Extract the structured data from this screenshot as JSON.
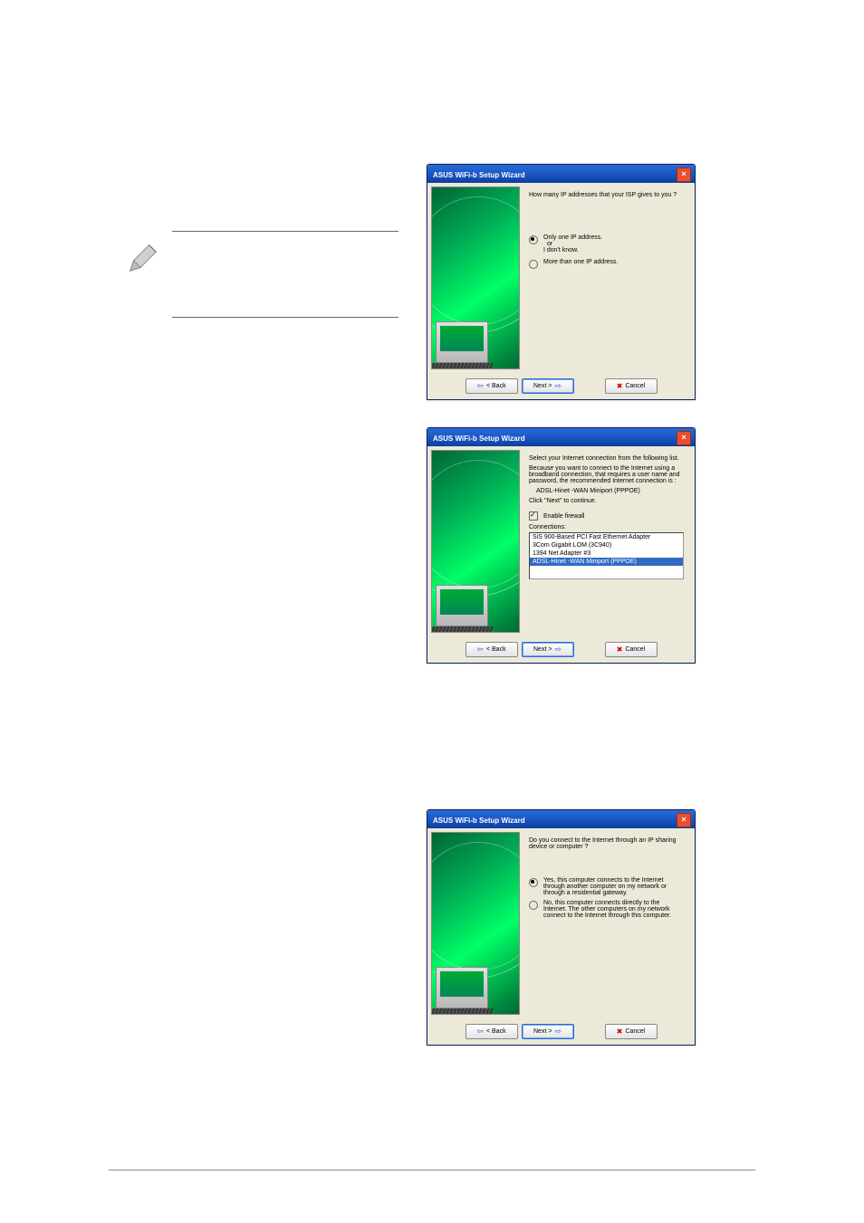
{
  "wizard_title": "ASUS WiFi-b Setup Wizard",
  "buttons": {
    "back": "< Back",
    "next": "Next >",
    "cancel": "Cancel"
  },
  "dialog1": {
    "question": "How many IP addresses that your ISP gives to you ?",
    "opt1_line1": "Only one IP address.",
    "opt1_line2": "or",
    "opt1_line3": "I don't know.",
    "opt2": "More than one IP address."
  },
  "dialog2": {
    "line1": "Select your Internet connection from the following list.",
    "line2": "Because you want to connect to the Internet using a broadband connection, that requires a user name and password, the recommended Internet connection is :",
    "recommended": "ADSL-Hinet -WAN Miniport (PPPOE)",
    "line3": "Click \"Next\" to continue.",
    "firewall": "Enable firewall",
    "connections_label": "Connections:",
    "items": [
      "SiS 900-Based PCI Fast Ethernet Adapter",
      "3Com Gigabit LOM (3C940)",
      "1394 Net Adapter #3",
      "ADSL-Hinet -WAN Miniport (PPPOE)"
    ]
  },
  "dialog3": {
    "question": "Do you connect to the Internet through an IP sharing device or computer ?",
    "opt1": "Yes, this computer connects to the Internet through another computer on my network or through a residential gateway.",
    "opt2": "No, this computer connects directly to the Internet. The other computers on my network connect to the Internet through this computer."
  }
}
